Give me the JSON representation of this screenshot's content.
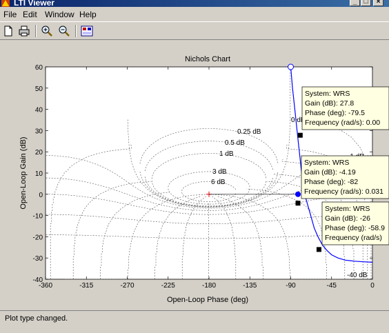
{
  "window": {
    "title": "LTI Viewer"
  },
  "menu": [
    "File",
    "Edit",
    "Window",
    "Help"
  ],
  "toolbar": {
    "icons": [
      "new-icon",
      "print-icon",
      "zoom-in-icon",
      "zoom-out-icon",
      "plot-configurations-icon"
    ]
  },
  "chart_data": {
    "type": "line",
    "title": "Nichols Chart",
    "xlabel": "Open-Loop Phase (deg)",
    "ylabel": "Open-Loop Gain (dB)",
    "xlim": [
      -360,
      0
    ],
    "ylim": [
      -40,
      60
    ],
    "xticks": [
      "-360",
      "-315",
      "-270",
      "-225",
      "-180",
      "-135",
      "-90",
      "-45",
      "0"
    ],
    "yticks": [
      "60",
      "50",
      "40",
      "30",
      "20",
      "10",
      "0",
      "-10",
      "-20",
      "-30",
      "-40"
    ],
    "grid": true,
    "grid_labels": [
      "0 dB",
      "0.25 dB",
      "0.5 dB",
      "1 dB",
      "3 dB",
      "6 dB",
      "-1 dB",
      "-40 dB"
    ],
    "series": [
      {
        "name": "WRS",
        "color": "#0000ff",
        "x": [
          -90,
          -88,
          -86,
          -84,
          -82,
          -80,
          -78,
          -76,
          -72,
          -68,
          -64,
          -60,
          -55,
          -50,
          -45,
          -38,
          -30,
          -20,
          -10,
          0
        ],
        "y": [
          60,
          50,
          42,
          34,
          26,
          18,
          10,
          2,
          -4,
          -10,
          -16,
          -20,
          -24,
          -26.5,
          -28.5,
          -30,
          -31,
          -31.5,
          -31.8,
          -32
        ]
      }
    ],
    "markers": [
      {
        "x": -90,
        "y": 60,
        "style": "open-circle"
      },
      {
        "x": -82,
        "y": 0,
        "style": "filled-circle"
      },
      {
        "x": -79.5,
        "y": 27.8,
        "style": "square"
      },
      {
        "x": -82,
        "y": -4.19,
        "style": "square"
      },
      {
        "x": -58.9,
        "y": -26,
        "style": "square"
      }
    ],
    "critical_point": {
      "x": -180,
      "y": 0
    },
    "datatips": [
      {
        "system": "System: WRS",
        "gain": "Gain (dB): 27.8",
        "phase": "Phase (deg): -79.5",
        "freq": "Frequency (rad/s): 0.00"
      },
      {
        "system": "System: WRS",
        "gain": "Gain (dB): -4.19",
        "phase": "Phase (deg): -82",
        "freq": "Frequency (rad/s): 0.031"
      },
      {
        "system": "System: WRS",
        "gain": "Gain (dB): -26",
        "phase": "Phase (deg): -58.9",
        "freq": "Frequency (rad/s)"
      }
    ]
  },
  "status": {
    "text": "Plot type changed."
  }
}
